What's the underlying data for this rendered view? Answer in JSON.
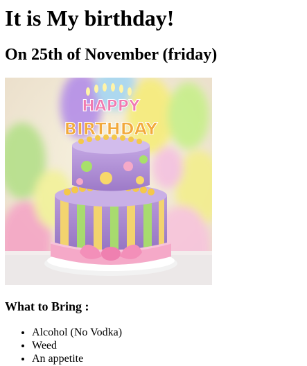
{
  "page": {
    "heading": "It is My birthday!",
    "subheading": "On 25th of November (friday)",
    "image": {
      "subject": "birthday cake with candles and balloons",
      "topper_text": "HAPPY BIRTHDAY"
    },
    "bring_heading": "What to Bring :",
    "bring_items": [
      "Alcohol (No Vodka)",
      "Weed",
      "An appetite"
    ]
  }
}
